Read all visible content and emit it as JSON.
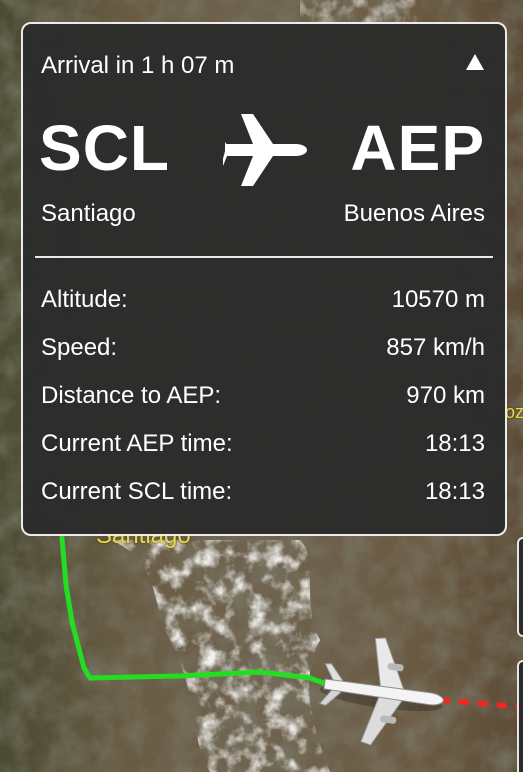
{
  "map": {
    "city_label": "Santiago",
    "edge_label": "oz",
    "colors": {
      "route_flown": "#22dd22",
      "route_remaining": "#ff2020",
      "label": "#e8d84a"
    }
  },
  "card": {
    "arrival_text": "Arrival in 1 h 07 m",
    "collapse_icon": "triangle-up-icon",
    "route_icon": "airplane-icon",
    "origin": {
      "code": "SCL",
      "city": "Santiago"
    },
    "destination": {
      "code": "AEP",
      "city": "Buenos Aires"
    },
    "stats": [
      {
        "label": "Altitude:",
        "value": "10570 m"
      },
      {
        "label": "Speed:",
        "value": "857 km/h"
      },
      {
        "label": "Distance to AEP:",
        "value": "970 km"
      },
      {
        "label": "Current AEP time:",
        "value": "18:13"
      },
      {
        "label": "Current SCL time:",
        "value": "18:13"
      }
    ]
  }
}
